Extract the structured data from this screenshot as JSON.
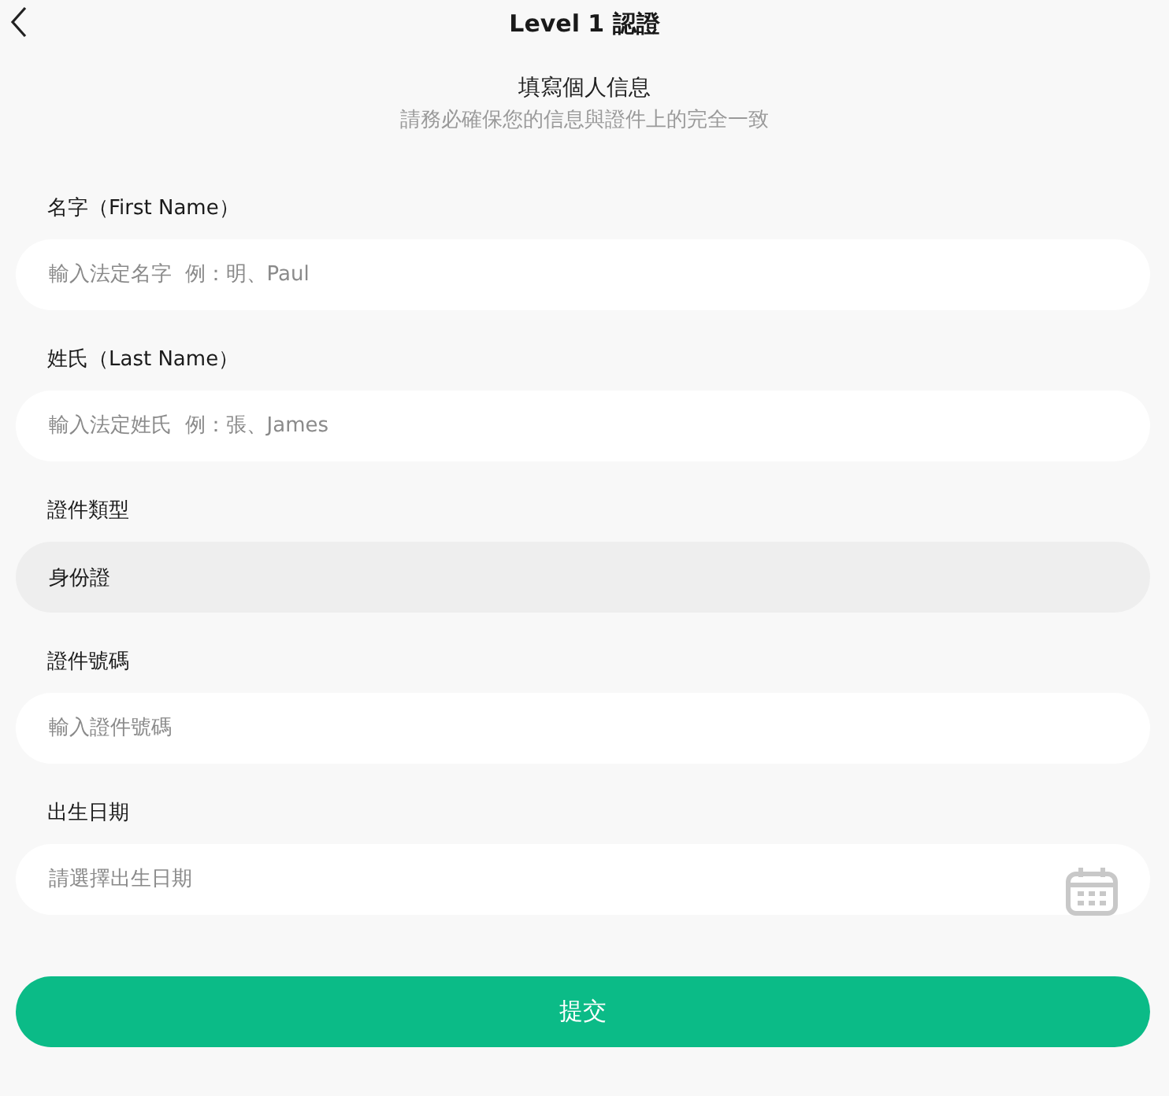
{
  "header": {
    "title": "Level 1 認證"
  },
  "intro": {
    "heading": "填寫個人信息",
    "subheading": "請務必確保您的信息與證件上的完全一致"
  },
  "fields": [
    {
      "kind": "input",
      "label": "名字（First Name）",
      "placeholder": "輸入法定名字  例：明、Paul"
    },
    {
      "kind": "input",
      "label": "姓氏（Last Name）",
      "placeholder": "輸入法定姓氏  例：張、James"
    },
    {
      "kind": "select",
      "label": "證件類型",
      "value": "身份證",
      "disabled": true
    },
    {
      "kind": "input",
      "label": "證件號碼",
      "placeholder": "輸入證件號碼"
    },
    {
      "kind": "date",
      "label": "出生日期",
      "placeholder": "請選擇出生日期"
    }
  ],
  "submit": {
    "label": "提交"
  }
}
